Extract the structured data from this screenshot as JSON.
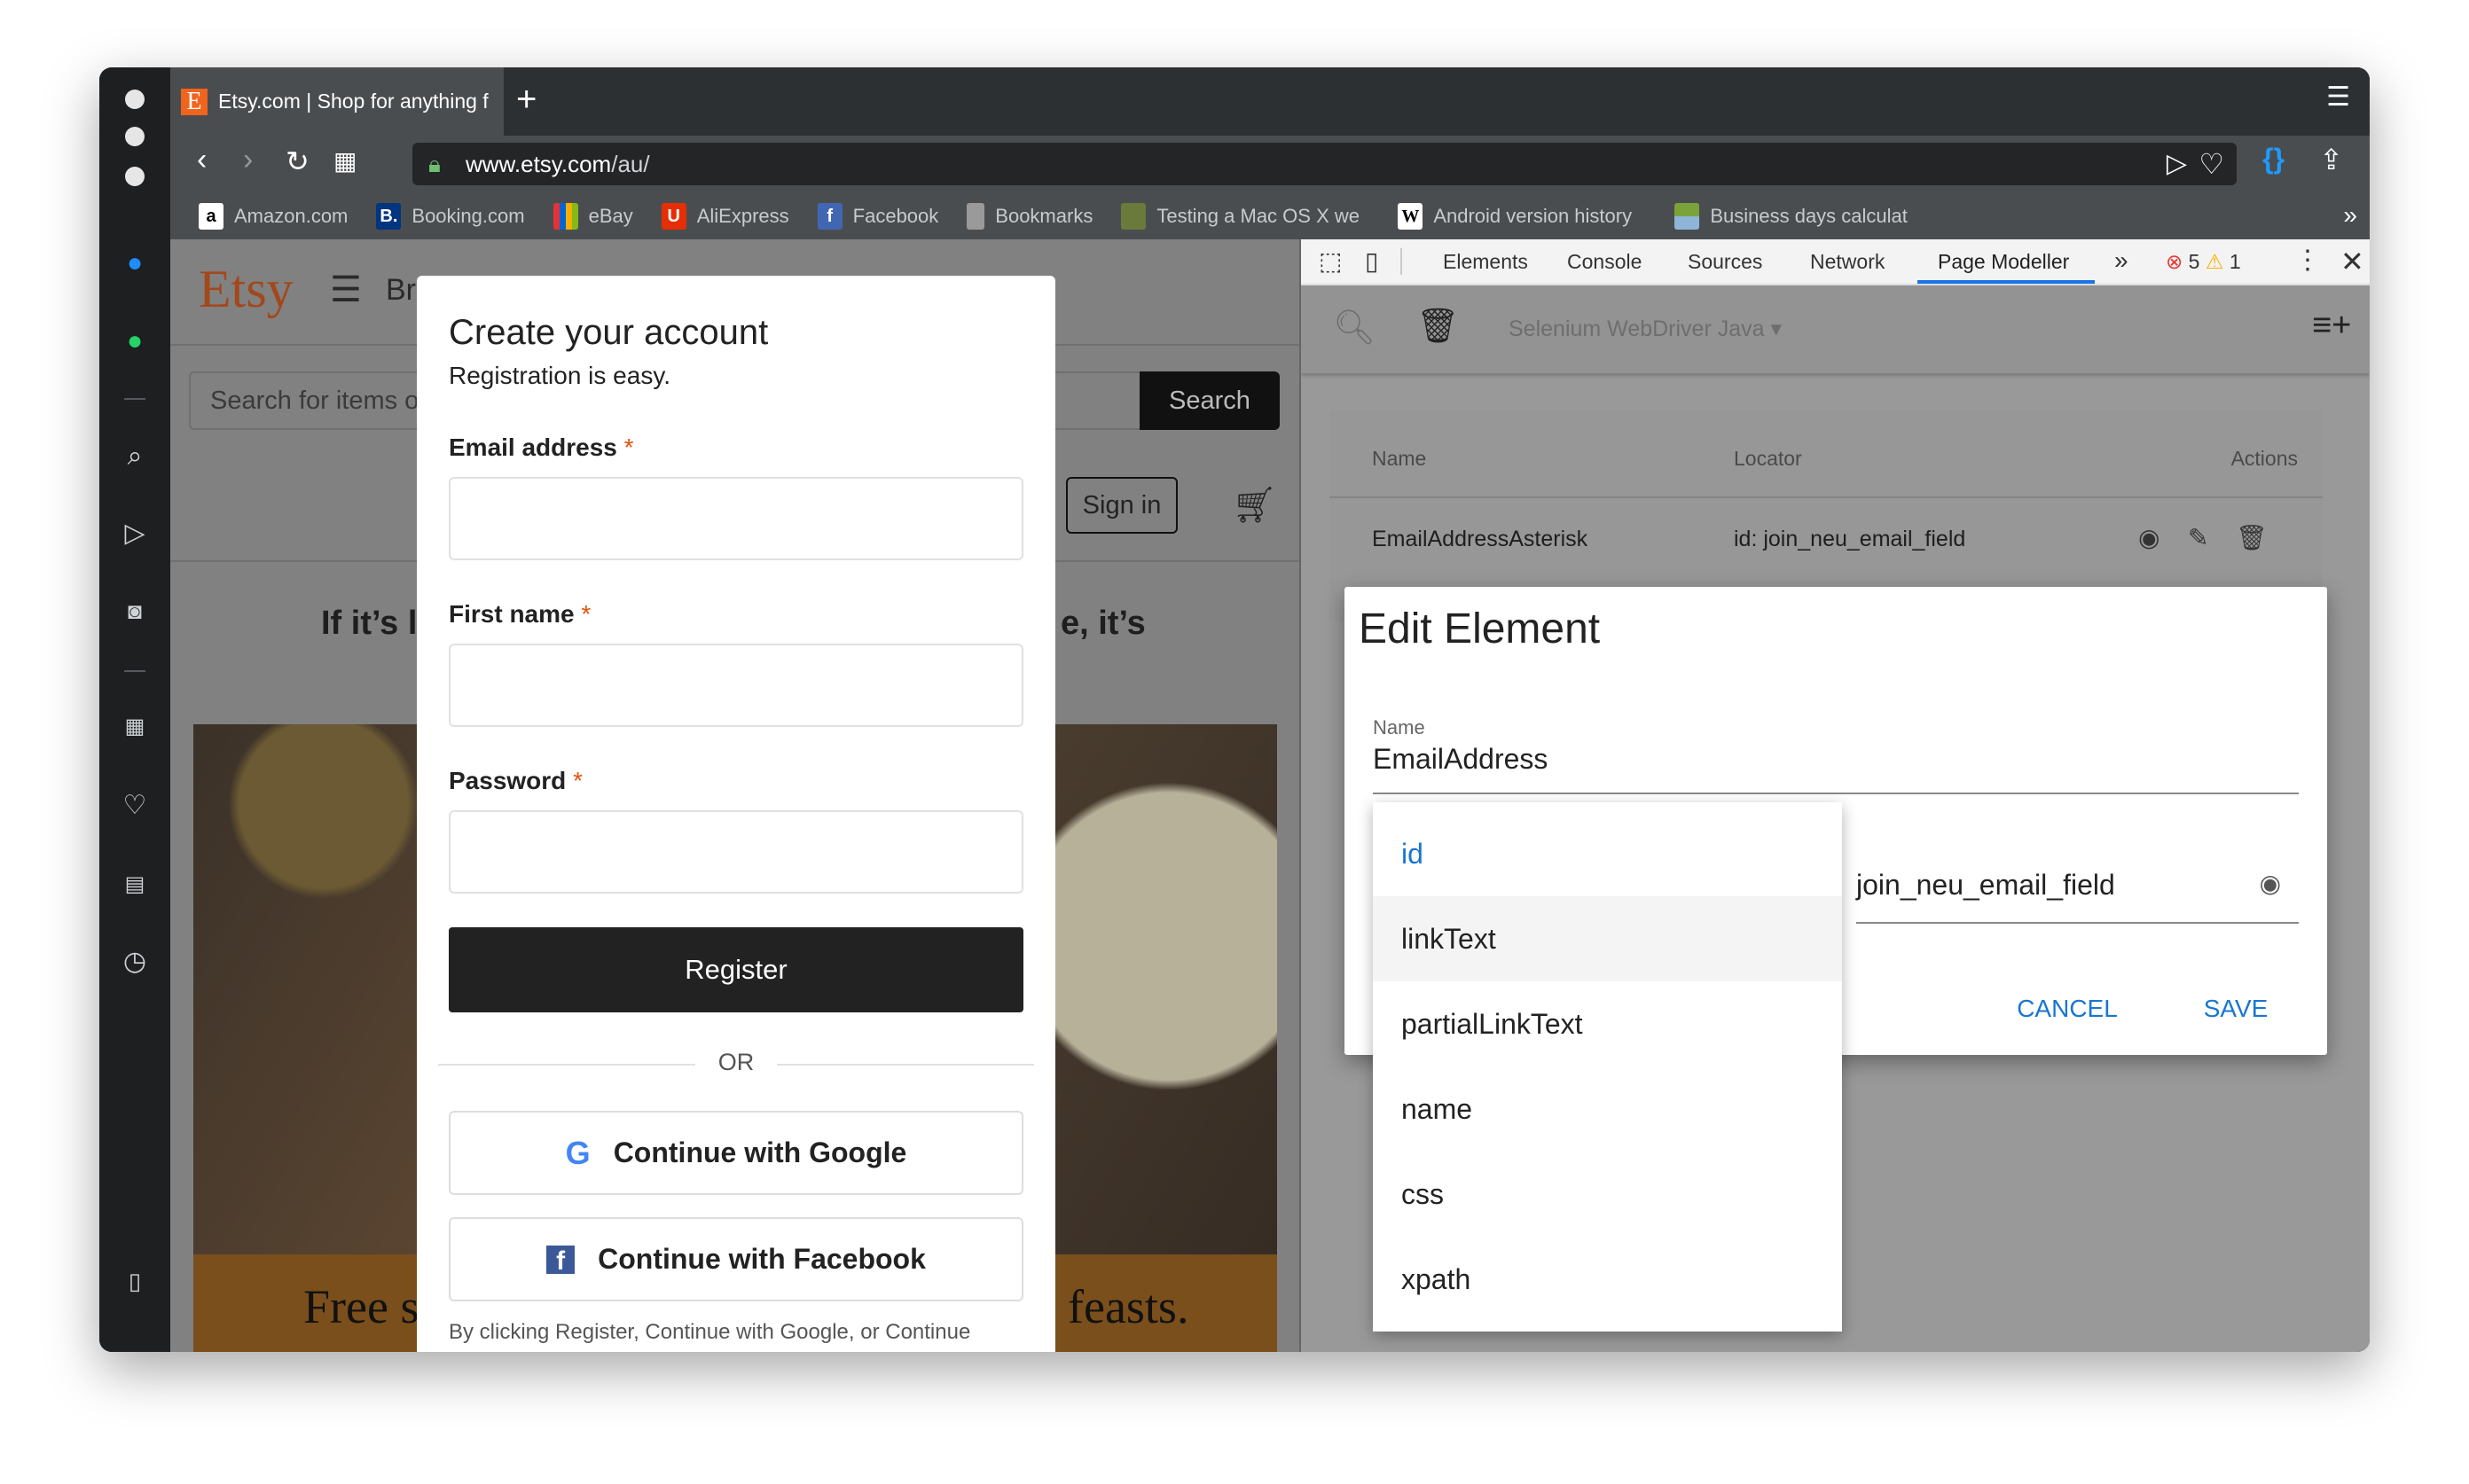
{
  "browser": {
    "tab_title": "Etsy.com | Shop for anything f",
    "new_tab_icon": "plus-icon",
    "url_domain": "www.etsy.com",
    "url_path": "/au/",
    "bookmarks": [
      {
        "label": "Amazon.com",
        "color": "#ffffff"
      },
      {
        "label": "Booking.com",
        "color": "#003580"
      },
      {
        "label": "eBay",
        "color": "#111111"
      },
      {
        "label": "AliExpress",
        "color": "#e62e04"
      },
      {
        "label": "Facebook",
        "color": "#4267b2"
      },
      {
        "label": "Bookmarks",
        "color": "#9a9a9a"
      },
      {
        "label": "Testing a Mac OS X we",
        "color": "#6a7a3a"
      },
      {
        "label": "Android version history",
        "color": "#ffffff"
      },
      {
        "label": "Business days calculat",
        "color": "#7aa33a"
      }
    ]
  },
  "etsy": {
    "logo": "Etsy",
    "browse": "Br",
    "search_placeholder": "Search for items or shops",
    "search_button": "Search",
    "sign_in": "Sign in",
    "headline_left": "If it’s l",
    "headline_right": "e, it’s",
    "banner_left": "Free s",
    "banner_right": "feasts."
  },
  "modal": {
    "title": "Create your account",
    "subtitle": "Registration is easy.",
    "email_label": "Email address",
    "first_name_label": "First name",
    "password_label": "Password",
    "required_mark": "*",
    "register": "Register",
    "or": "OR",
    "google": "Continue with Google",
    "facebook": "Continue with Facebook",
    "disclaimer": "By clicking Register, Continue with Google, or Continue"
  },
  "devtools": {
    "tabs": [
      "Elements",
      "Console",
      "Sources",
      "Network",
      "Page Modeller"
    ],
    "active_tab": "Page Modeller",
    "more": "»",
    "errors": "5",
    "warnings": "1",
    "framework": "Selenium WebDriver Java",
    "table": {
      "headers": [
        "Name",
        "Locator",
        "Actions"
      ],
      "rows": [
        {
          "name": "EmailAddressAsterisk",
          "locator": "id: join_neu_email_field"
        }
      ]
    },
    "dialog": {
      "title": "Edit Element",
      "name_label": "Name",
      "name_value": "EmailAddress",
      "locator_value": "join_neu_email_field",
      "options": [
        "id",
        "linkText",
        "partialLinkText",
        "name",
        "css",
        "xpath"
      ],
      "selected_option": "id",
      "hovered_option": "linkText",
      "cancel": "CANCEL",
      "save": "SAVE",
      "accent": "#1976d2"
    }
  }
}
